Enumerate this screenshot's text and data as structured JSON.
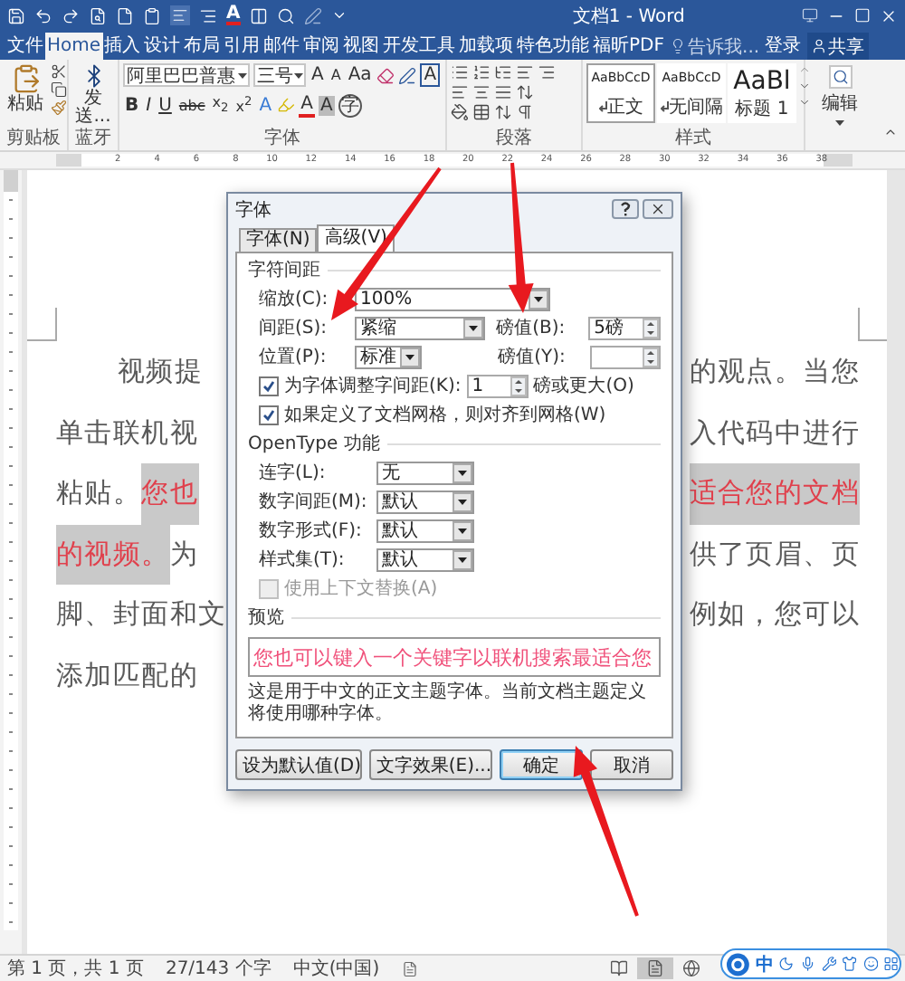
{
  "window": {
    "title": "文档1 - Word",
    "quick_access_letter": "A"
  },
  "tabs": [
    {
      "label": "文件",
      "selected": false
    },
    {
      "label": "Home",
      "selected": true
    },
    {
      "label": "插入",
      "selected": false
    },
    {
      "label": "设计",
      "selected": false
    },
    {
      "label": "布局",
      "selected": false
    },
    {
      "label": "引用",
      "selected": false
    },
    {
      "label": "邮件",
      "selected": false
    },
    {
      "label": "审阅",
      "selected": false
    },
    {
      "label": "视图",
      "selected": false
    },
    {
      "label": "开发工具",
      "selected": false
    },
    {
      "label": "加载项",
      "selected": false
    },
    {
      "label": "特色功能",
      "selected": false
    },
    {
      "label": "福昕PDF",
      "selected": false
    }
  ],
  "tell_me": {
    "placeholder": "告诉我..."
  },
  "sign_in": "登录",
  "share": "共享",
  "ribbon": {
    "clipboard": {
      "paste": "粘贴",
      "label": "剪贴板"
    },
    "bluetooth": {
      "send": "发送...",
      "label": "蓝牙"
    },
    "font": {
      "name": "阿里巴巴普惠",
      "size": "三号",
      "top_buttons": [
        "A",
        "A",
        "Aa"
      ],
      "border_letter": "A",
      "bottom_buttons": [
        "B",
        "I",
        "U",
        "abc",
        "x$_{2}$",
        "x$^{2}$"
      ],
      "effect_letter": "A",
      "color_letter": "A",
      "shading_letter": "A",
      "enclosed": "字",
      "label": "字体"
    },
    "paragraph": {
      "label": "段落"
    },
    "styles": {
      "items": [
        {
          "preview": "AaBbCcD",
          "name": "正文",
          "selected": true
        },
        {
          "preview": "AaBbCcD",
          "name": "无间隔",
          "selected": false
        },
        {
          "preview": "AaBl",
          "name": "标题 1",
          "selected": false
        }
      ],
      "label": "样式"
    },
    "editing": {
      "label": "编辑"
    }
  },
  "ruler": {
    "numbers": [
      "2",
      "4",
      "6",
      "8",
      "10",
      "12",
      "14",
      "16",
      "18",
      "20",
      "22",
      "24",
      "26",
      "28",
      "30",
      "32",
      "34",
      "36",
      "38"
    ]
  },
  "document": {
    "lines": [
      {
        "indented": true,
        "left": [
          {
            "text": "视频提",
            "highlighted": false
          }
        ],
        "right": [
          {
            "text": "的观点。当您",
            "highlighted": false
          }
        ]
      },
      {
        "indented": false,
        "left": [
          {
            "text": "单击联机视",
            "highlighted": false
          }
        ],
        "right": [
          {
            "text": "入代码中进行",
            "highlighted": false
          }
        ]
      },
      {
        "indented": false,
        "left": [
          {
            "text": "粘贴。",
            "highlighted": false
          },
          {
            "text": "您也",
            "highlighted": true
          }
        ],
        "right": [
          {
            "text": "适合您的文档",
            "highlighted": true
          }
        ]
      },
      {
        "indented": false,
        "left": [
          {
            "text": "的视频。",
            "highlighted": true
          },
          {
            "text": "为",
            "highlighted": false
          }
        ],
        "right": [
          {
            "text": "供了页眉、页",
            "highlighted": false
          }
        ]
      },
      {
        "indented": false,
        "left": [
          {
            "text": "脚、封面和文",
            "highlighted": false
          }
        ],
        "right": [
          {
            "text": "例如，您可以",
            "highlighted": false
          }
        ]
      },
      {
        "indented": false,
        "left": [
          {
            "text": "添加匹配的",
            "highlighted": false
          }
        ]
      }
    ]
  },
  "dialog": {
    "title": "字体",
    "tabs": [
      {
        "label": "字体(N)",
        "selected": false
      },
      {
        "label": "高级(V)",
        "selected": true
      }
    ],
    "spacing_section": {
      "title": "字符间距",
      "scale": {
        "label": "缩放(C):",
        "value": "100%"
      },
      "spacing": {
        "label": "间距(S):",
        "value": "紧缩",
        "by_label": "磅值(B):",
        "by_value": "5磅"
      },
      "position": {
        "label": "位置(P):",
        "value": "标准",
        "by_label": "磅值(Y):"
      },
      "kerning": {
        "label": "为字体调整字间距(K):",
        "checked": true,
        "value": "1",
        "suffix": "磅或更大(O)"
      },
      "snap": {
        "label": "如果定义了文档网格，则对齐到网格(W)",
        "checked": true
      }
    },
    "opentype_section": {
      "title": "OpenType 功能",
      "rows": [
        {
          "label": "连字(L):",
          "value": "无"
        },
        {
          "label": "数字间距(M):",
          "value": "默认"
        },
        {
          "label": "数字形式(F):",
          "value": "默认"
        },
        {
          "label": "样式集(T):",
          "value": "默认"
        }
      ],
      "contextual": {
        "label": "使用上下文替换(A)",
        "checked": false,
        "disabled": true
      }
    },
    "preview_section": {
      "title": "预览",
      "sample": "您也可以键入一个关键字以联机搜索最适合您",
      "note": "这是用于中文的正文主题字体。当前文档主题定义将使用哪种字体。"
    },
    "buttons": [
      {
        "label": "设为默认值(D)",
        "default": false
      },
      {
        "label": "文字效果(E)...",
        "default": false
      },
      {
        "label": "确定",
        "default": true
      },
      {
        "label": "取消",
        "default": false
      }
    ]
  },
  "status_bar": {
    "page": "第 1 页，共 1 页",
    "words": "27/143 个字",
    "language": "中文(中国)"
  },
  "view_buttons": [
    {
      "kind": "read",
      "selected": false
    },
    {
      "kind": "print",
      "selected": true
    },
    {
      "kind": "web",
      "selected": false
    }
  ],
  "ime_bar": {
    "mode": "中"
  }
}
